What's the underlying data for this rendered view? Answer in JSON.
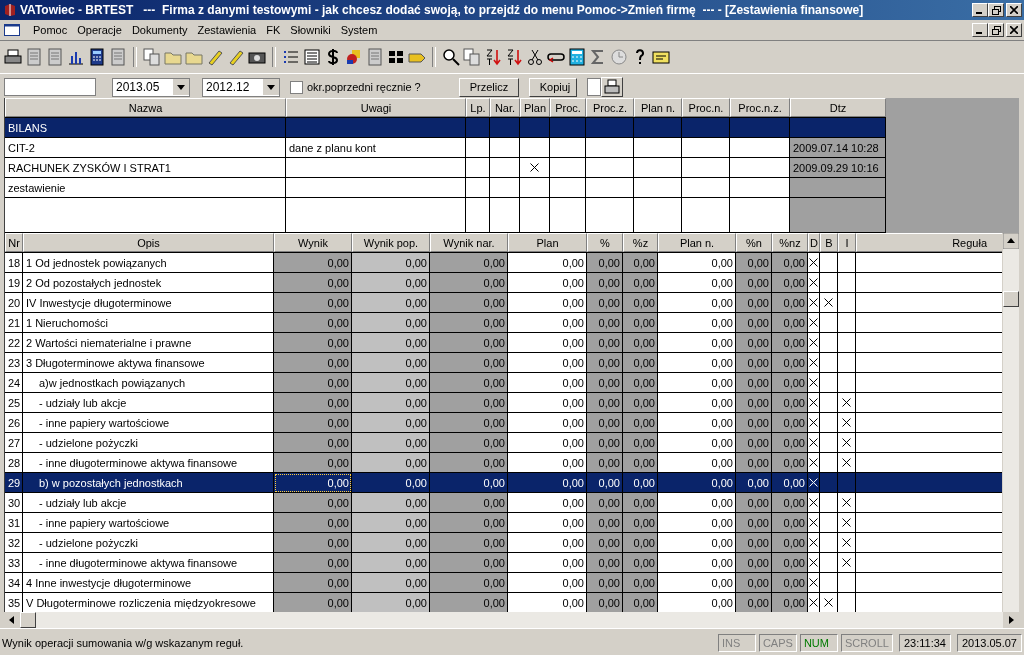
{
  "window": {
    "title": "VATowiec - BRTEST   ---  Firma z danymi testowymi - jak chcesz dodać swoją, to przejdź do menu Pomoc->Zmień firmę  --- - [Zestawienia finansowe]"
  },
  "menu": [
    "Pomoc",
    "Operacje",
    "Dokumenty",
    "Zestawienia",
    "FK",
    "Słowniki",
    "System"
  ],
  "filter": {
    "period": "2013.05",
    "previous_period": "2012.12",
    "manual_previous": {
      "label": "okr.poprzedni ręcznie ?",
      "checked": false
    },
    "buttons": [
      "Przelicz",
      "Kopiuj"
    ]
  },
  "statements": {
    "columns": [
      "Nazwa",
      "Uwagi",
      "Lp.",
      "Nar.",
      "Plan",
      "Proc.",
      "Proc.z.",
      "Plan n.",
      "Proc.n.",
      "Proc.n.z.",
      "Dtz"
    ],
    "rows": [
      {
        "name": "BILANS",
        "note": "",
        "plan": false,
        "dtz": "",
        "selected": true
      },
      {
        "name": "CIT-2",
        "note": "dane z planu kont",
        "plan": false,
        "dtz": "2009.07.14 10:28",
        "selected": false
      },
      {
        "name": "RACHUNEK ZYSKÓW I STRAT1",
        "note": "",
        "plan": true,
        "dtz": "2009.09.29 10:16",
        "selected": false
      },
      {
        "name": "zestawienie",
        "note": "",
        "plan": false,
        "dtz": "",
        "selected": false
      }
    ]
  },
  "positions": {
    "columns": [
      "Nr",
      "Opis",
      "Wynik",
      "Wynik pop.",
      "Wynik nar.",
      "Plan",
      "%",
      "%z",
      "Plan n.",
      "%n",
      "%nz",
      "D",
      "B",
      "I",
      "Reguła"
    ],
    "rows": [
      {
        "nr": "18",
        "opis": "1 Od jednostek powiązanych",
        "kind": "top",
        "values": [
          "0,00",
          "0,00",
          "0,00",
          "0,00",
          "0,00",
          "0,00",
          "0,00",
          "0,00",
          "0,00"
        ],
        "d": true,
        "b": false,
        "i": false,
        "selected": false
      },
      {
        "nr": "19",
        "opis": "2 Od pozostałych jednostek",
        "kind": "top",
        "values": [
          "0,00",
          "0,00",
          "0,00",
          "0,00",
          "0,00",
          "0,00",
          "0,00",
          "0,00",
          "0,00"
        ],
        "d": true,
        "b": false,
        "i": false,
        "selected": false
      },
      {
        "nr": "20",
        "opis": "IV Inwestycje długoterminowe",
        "kind": "top",
        "values": [
          "0,00",
          "0,00",
          "0,00",
          "0,00",
          "0,00",
          "0,00",
          "0,00",
          "0,00",
          "0,00"
        ],
        "d": true,
        "b": true,
        "i": false,
        "selected": false
      },
      {
        "nr": "21",
        "opis": "1 Nieruchomości",
        "kind": "top",
        "values": [
          "0,00",
          "0,00",
          "0,00",
          "0,00",
          "0,00",
          "0,00",
          "0,00",
          "0,00",
          "0,00"
        ],
        "d": true,
        "b": false,
        "i": false,
        "selected": false
      },
      {
        "nr": "22",
        "opis": "2 Wartości niematerialne i prawne",
        "kind": "top",
        "values": [
          "0,00",
          "0,00",
          "0,00",
          "0,00",
          "0,00",
          "0,00",
          "0,00",
          "0,00",
          "0,00"
        ],
        "d": true,
        "b": false,
        "i": false,
        "selected": false
      },
      {
        "nr": "23",
        "opis": "3 Długoterminowe aktywa finansowe",
        "kind": "top",
        "values": [
          "0,00",
          "0,00",
          "0,00",
          "0,00",
          "0,00",
          "0,00",
          "0,00",
          "0,00",
          "0,00"
        ],
        "d": true,
        "b": false,
        "i": false,
        "selected": false
      },
      {
        "nr": "24",
        "opis": "a)w jednostkach powiązanych",
        "kind": "sub",
        "values": [
          "0,00",
          "0,00",
          "0,00",
          "0,00",
          "0,00",
          "0,00",
          "0,00",
          "0,00",
          "0,00"
        ],
        "d": true,
        "b": false,
        "i": false,
        "selected": false
      },
      {
        "nr": "25",
        "opis": "- udziały lub akcje",
        "kind": "sub",
        "values": [
          "0,00",
          "0,00",
          "0,00",
          "0,00",
          "0,00",
          "0,00",
          "0,00",
          "0,00",
          "0,00"
        ],
        "d": true,
        "b": false,
        "i": true,
        "selected": false
      },
      {
        "nr": "26",
        "opis": "- inne papiery wartościowe",
        "kind": "sub",
        "values": [
          "0,00",
          "0,00",
          "0,00",
          "0,00",
          "0,00",
          "0,00",
          "0,00",
          "0,00",
          "0,00"
        ],
        "d": true,
        "b": false,
        "i": true,
        "selected": false
      },
      {
        "nr": "27",
        "opis": "- udzielone pożyczki",
        "kind": "sub",
        "values": [
          "0,00",
          "0,00",
          "0,00",
          "0,00",
          "0,00",
          "0,00",
          "0,00",
          "0,00",
          "0,00"
        ],
        "d": true,
        "b": false,
        "i": true,
        "selected": false
      },
      {
        "nr": "28",
        "opis": "- inne długoterminowe aktywa  finansowe",
        "kind": "sub",
        "values": [
          "0,00",
          "0,00",
          "0,00",
          "0,00",
          "0,00",
          "0,00",
          "0,00",
          "0,00",
          "0,00"
        ],
        "d": true,
        "b": false,
        "i": true,
        "selected": false
      },
      {
        "nr": "29",
        "opis": "b) w pozostałych jednostkach",
        "kind": "sub",
        "values": [
          "0,00",
          "0,00",
          "0,00",
          "0,00",
          "0,00",
          "0,00",
          "0,00",
          "0,00",
          "0,00"
        ],
        "d": true,
        "b": false,
        "i": false,
        "selected": true
      },
      {
        "nr": "30",
        "opis": "- udziały lub akcje",
        "kind": "sub",
        "values": [
          "0,00",
          "0,00",
          "0,00",
          "0,00",
          "0,00",
          "0,00",
          "0,00",
          "0,00",
          "0,00"
        ],
        "d": true,
        "b": false,
        "i": true,
        "selected": false
      },
      {
        "nr": "31",
        "opis": "- inne papiery wartościowe",
        "kind": "sub",
        "values": [
          "0,00",
          "0,00",
          "0,00",
          "0,00",
          "0,00",
          "0,00",
          "0,00",
          "0,00",
          "0,00"
        ],
        "d": true,
        "b": false,
        "i": true,
        "selected": false
      },
      {
        "nr": "32",
        "opis": "- udzielone pożyczki",
        "kind": "sub",
        "values": [
          "0,00",
          "0,00",
          "0,00",
          "0,00",
          "0,00",
          "0,00",
          "0,00",
          "0,00",
          "0,00"
        ],
        "d": true,
        "b": false,
        "i": true,
        "selected": false
      },
      {
        "nr": "33",
        "opis": "- inne długoterminowe aktywa finansowe",
        "kind": "sub",
        "values": [
          "0,00",
          "0,00",
          "0,00",
          "0,00",
          "0,00",
          "0,00",
          "0,00",
          "0,00",
          "0,00"
        ],
        "d": true,
        "b": false,
        "i": true,
        "selected": false
      },
      {
        "nr": "34",
        "opis": "4 Inne inwestycje długoterminowe",
        "kind": "top",
        "values": [
          "0,00",
          "0,00",
          "0,00",
          "0,00",
          "0,00",
          "0,00",
          "0,00",
          "0,00",
          "0,00"
        ],
        "d": true,
        "b": false,
        "i": false,
        "selected": false
      },
      {
        "nr": "35",
        "opis": "V Długoterminowe rozliczenia międzyokresowe",
        "kind": "top",
        "values": [
          "0,00",
          "0,00",
          "0,00",
          "0,00",
          "0,00",
          "0,00",
          "0,00",
          "0,00",
          "0,00"
        ],
        "d": true,
        "b": true,
        "i": false,
        "selected": false
      }
    ]
  },
  "status_bar": {
    "message": "Wynik operacji sumowania w/g wskazanym reguł.",
    "indicators": [
      {
        "label": "INS",
        "on": false
      },
      {
        "label": "CAPS",
        "on": false
      },
      {
        "label": "NUM",
        "on": true
      },
      {
        "label": "SCROLL",
        "on": false
      }
    ],
    "time": "23:11:34",
    "date": "2013.05.07"
  }
}
